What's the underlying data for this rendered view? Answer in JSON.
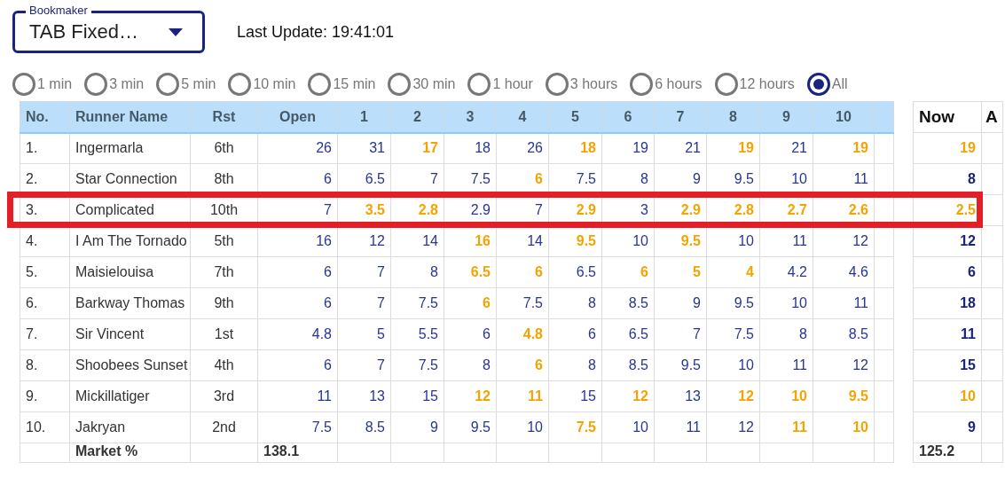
{
  "bookmaker": {
    "label": "Bookmaker",
    "value": "TAB Fixed…"
  },
  "last_update": "Last Update: 19:41:01",
  "intervals": [
    {
      "label": "1 min",
      "selected": false
    },
    {
      "label": "3 min",
      "selected": false
    },
    {
      "label": "5 min",
      "selected": false
    },
    {
      "label": "10 min",
      "selected": false
    },
    {
      "label": "15 min",
      "selected": false
    },
    {
      "label": "30 min",
      "selected": false
    },
    {
      "label": "1 hour",
      "selected": false
    },
    {
      "label": "3 hours",
      "selected": false
    },
    {
      "label": "6 hours",
      "selected": false
    },
    {
      "label": "12 hours",
      "selected": false
    },
    {
      "label": "All",
      "selected": true
    }
  ],
  "table": {
    "columns": [
      "No.",
      "Runner Name",
      "Rst",
      "Open",
      "1",
      "2",
      "3",
      "4",
      "5",
      "6",
      "7",
      "8",
      "9",
      "10"
    ],
    "now_column": "Now",
    "column_15": "A",
    "rows": [
      {
        "no": "1.",
        "name": "Ingermarla",
        "rst": "6th",
        "highlighted": false,
        "prices": [
          {
            "v": "26",
            "emphasized": false
          },
          {
            "v": "31",
            "emphasized": false
          },
          {
            "v": "17",
            "emphasized": true
          },
          {
            "v": "18",
            "emphasized": false
          },
          {
            "v": "26",
            "emphasized": false
          },
          {
            "v": "18",
            "emphasized": true
          },
          {
            "v": "19",
            "emphasized": false
          },
          {
            "v": "21",
            "emphasized": false
          },
          {
            "v": "19",
            "emphasized": true
          },
          {
            "v": "21",
            "emphasized": false
          },
          {
            "v": "19",
            "emphasized": true
          }
        ],
        "now": {
          "v": "19",
          "emphasized": true
        }
      },
      {
        "no": "2.",
        "name": "Star Connection",
        "rst": "8th",
        "highlighted": false,
        "prices": [
          {
            "v": "6",
            "emphasized": false
          },
          {
            "v": "6.5",
            "emphasized": false
          },
          {
            "v": "7",
            "emphasized": false
          },
          {
            "v": "7.5",
            "emphasized": false
          },
          {
            "v": "6",
            "emphasized": true
          },
          {
            "v": "7.5",
            "emphasized": false
          },
          {
            "v": "8",
            "emphasized": false
          },
          {
            "v": "9",
            "emphasized": false
          },
          {
            "v": "9.5",
            "emphasized": false
          },
          {
            "v": "10",
            "emphasized": false
          },
          {
            "v": "11",
            "emphasized": false
          }
        ],
        "now": {
          "v": "8",
          "emphasized": false
        }
      },
      {
        "no": "3.",
        "name": "Complicated",
        "rst": "10th",
        "highlighted": true,
        "prices": [
          {
            "v": "7",
            "emphasized": false
          },
          {
            "v": "3.5",
            "emphasized": true
          },
          {
            "v": "2.8",
            "emphasized": true
          },
          {
            "v": "2.9",
            "emphasized": false
          },
          {
            "v": "7",
            "emphasized": false
          },
          {
            "v": "2.9",
            "emphasized": true
          },
          {
            "v": "3",
            "emphasized": false
          },
          {
            "v": "2.9",
            "emphasized": true
          },
          {
            "v": "2.8",
            "emphasized": true
          },
          {
            "v": "2.7",
            "emphasized": true
          },
          {
            "v": "2.6",
            "emphasized": true
          }
        ],
        "now": {
          "v": "2.5",
          "emphasized": true
        }
      },
      {
        "no": "4.",
        "name": "I Am The Tornado",
        "rst": "5th",
        "highlighted": false,
        "prices": [
          {
            "v": "16",
            "emphasized": false
          },
          {
            "v": "12",
            "emphasized": false
          },
          {
            "v": "14",
            "emphasized": false
          },
          {
            "v": "16",
            "emphasized": true
          },
          {
            "v": "14",
            "emphasized": false
          },
          {
            "v": "9.5",
            "emphasized": true
          },
          {
            "v": "10",
            "emphasized": false
          },
          {
            "v": "9.5",
            "emphasized": true
          },
          {
            "v": "10",
            "emphasized": false
          },
          {
            "v": "11",
            "emphasized": false
          },
          {
            "v": "12",
            "emphasized": false
          }
        ],
        "now": {
          "v": "12",
          "emphasized": false
        }
      },
      {
        "no": "5.",
        "name": "Maisielouisa",
        "rst": "7th",
        "highlighted": false,
        "prices": [
          {
            "v": "6",
            "emphasized": false
          },
          {
            "v": "7",
            "emphasized": false
          },
          {
            "v": "8",
            "emphasized": false
          },
          {
            "v": "6.5",
            "emphasized": true
          },
          {
            "v": "6",
            "emphasized": true
          },
          {
            "v": "6.5",
            "emphasized": false
          },
          {
            "v": "6",
            "emphasized": true
          },
          {
            "v": "5",
            "emphasized": true
          },
          {
            "v": "4",
            "emphasized": true
          },
          {
            "v": "4.2",
            "emphasized": false
          },
          {
            "v": "4.6",
            "emphasized": false
          }
        ],
        "now": {
          "v": "6",
          "emphasized": false
        }
      },
      {
        "no": "6.",
        "name": "Barkway Thomas",
        "rst": "9th",
        "highlighted": false,
        "prices": [
          {
            "v": "6",
            "emphasized": false
          },
          {
            "v": "7",
            "emphasized": false
          },
          {
            "v": "7.5",
            "emphasized": false
          },
          {
            "v": "6",
            "emphasized": true
          },
          {
            "v": "7.5",
            "emphasized": false
          },
          {
            "v": "8",
            "emphasized": false
          },
          {
            "v": "8.5",
            "emphasized": false
          },
          {
            "v": "9",
            "emphasized": false
          },
          {
            "v": "9.5",
            "emphasized": false
          },
          {
            "v": "10",
            "emphasized": false
          },
          {
            "v": "11",
            "emphasized": false
          }
        ],
        "now": {
          "v": "18",
          "emphasized": false
        }
      },
      {
        "no": "7.",
        "name": "Sir Vincent",
        "rst": "1st",
        "highlighted": false,
        "prices": [
          {
            "v": "4.8",
            "emphasized": false
          },
          {
            "v": "5",
            "emphasized": false
          },
          {
            "v": "5.5",
            "emphasized": false
          },
          {
            "v": "6",
            "emphasized": false
          },
          {
            "v": "4.8",
            "emphasized": true
          },
          {
            "v": "6",
            "emphasized": false
          },
          {
            "v": "6.5",
            "emphasized": false
          },
          {
            "v": "7",
            "emphasized": false
          },
          {
            "v": "7.5",
            "emphasized": false
          },
          {
            "v": "8",
            "emphasized": false
          },
          {
            "v": "8.5",
            "emphasized": false
          }
        ],
        "now": {
          "v": "11",
          "emphasized": false
        }
      },
      {
        "no": "8.",
        "name": "Shoobees Sunset",
        "rst": "4th",
        "highlighted": false,
        "prices": [
          {
            "v": "6",
            "emphasized": false
          },
          {
            "v": "7",
            "emphasized": false
          },
          {
            "v": "7.5",
            "emphasized": false
          },
          {
            "v": "8",
            "emphasized": false
          },
          {
            "v": "6",
            "emphasized": true
          },
          {
            "v": "8",
            "emphasized": false
          },
          {
            "v": "8.5",
            "emphasized": false
          },
          {
            "v": "9.5",
            "emphasized": false
          },
          {
            "v": "10",
            "emphasized": false
          },
          {
            "v": "11",
            "emphasized": false
          },
          {
            "v": "12",
            "emphasized": false
          }
        ],
        "now": {
          "v": "15",
          "emphasized": false
        }
      },
      {
        "no": "9.",
        "name": "Mickillatiger",
        "rst": "3rd",
        "highlighted": false,
        "prices": [
          {
            "v": "11",
            "emphasized": false
          },
          {
            "v": "13",
            "emphasized": false
          },
          {
            "v": "15",
            "emphasized": false
          },
          {
            "v": "12",
            "emphasized": true
          },
          {
            "v": "11",
            "emphasized": true
          },
          {
            "v": "15",
            "emphasized": false
          },
          {
            "v": "12",
            "emphasized": true
          },
          {
            "v": "13",
            "emphasized": false
          },
          {
            "v": "12",
            "emphasized": true
          },
          {
            "v": "10",
            "emphasized": true
          },
          {
            "v": "9.5",
            "emphasized": true
          }
        ],
        "now": {
          "v": "10",
          "emphasized": true
        }
      },
      {
        "no": "10.",
        "name": "Jakryan",
        "rst": "2nd",
        "highlighted": false,
        "prices": [
          {
            "v": "7.5",
            "emphasized": false
          },
          {
            "v": "8.5",
            "emphasized": false
          },
          {
            "v": "9",
            "emphasized": false
          },
          {
            "v": "9.5",
            "emphasized": false
          },
          {
            "v": "10",
            "emphasized": false
          },
          {
            "v": "7.5",
            "emphasized": true
          },
          {
            "v": "10",
            "emphasized": false
          },
          {
            "v": "11",
            "emphasized": false
          },
          {
            "v": "12",
            "emphasized": false
          },
          {
            "v": "11",
            "emphasized": true
          },
          {
            "v": "10",
            "emphasized": true
          }
        ],
        "now": {
          "v": "9",
          "emphasized": false
        }
      }
    ],
    "footer": {
      "label": "Market %",
      "open": "138.1",
      "now": "125.2"
    }
  }
}
